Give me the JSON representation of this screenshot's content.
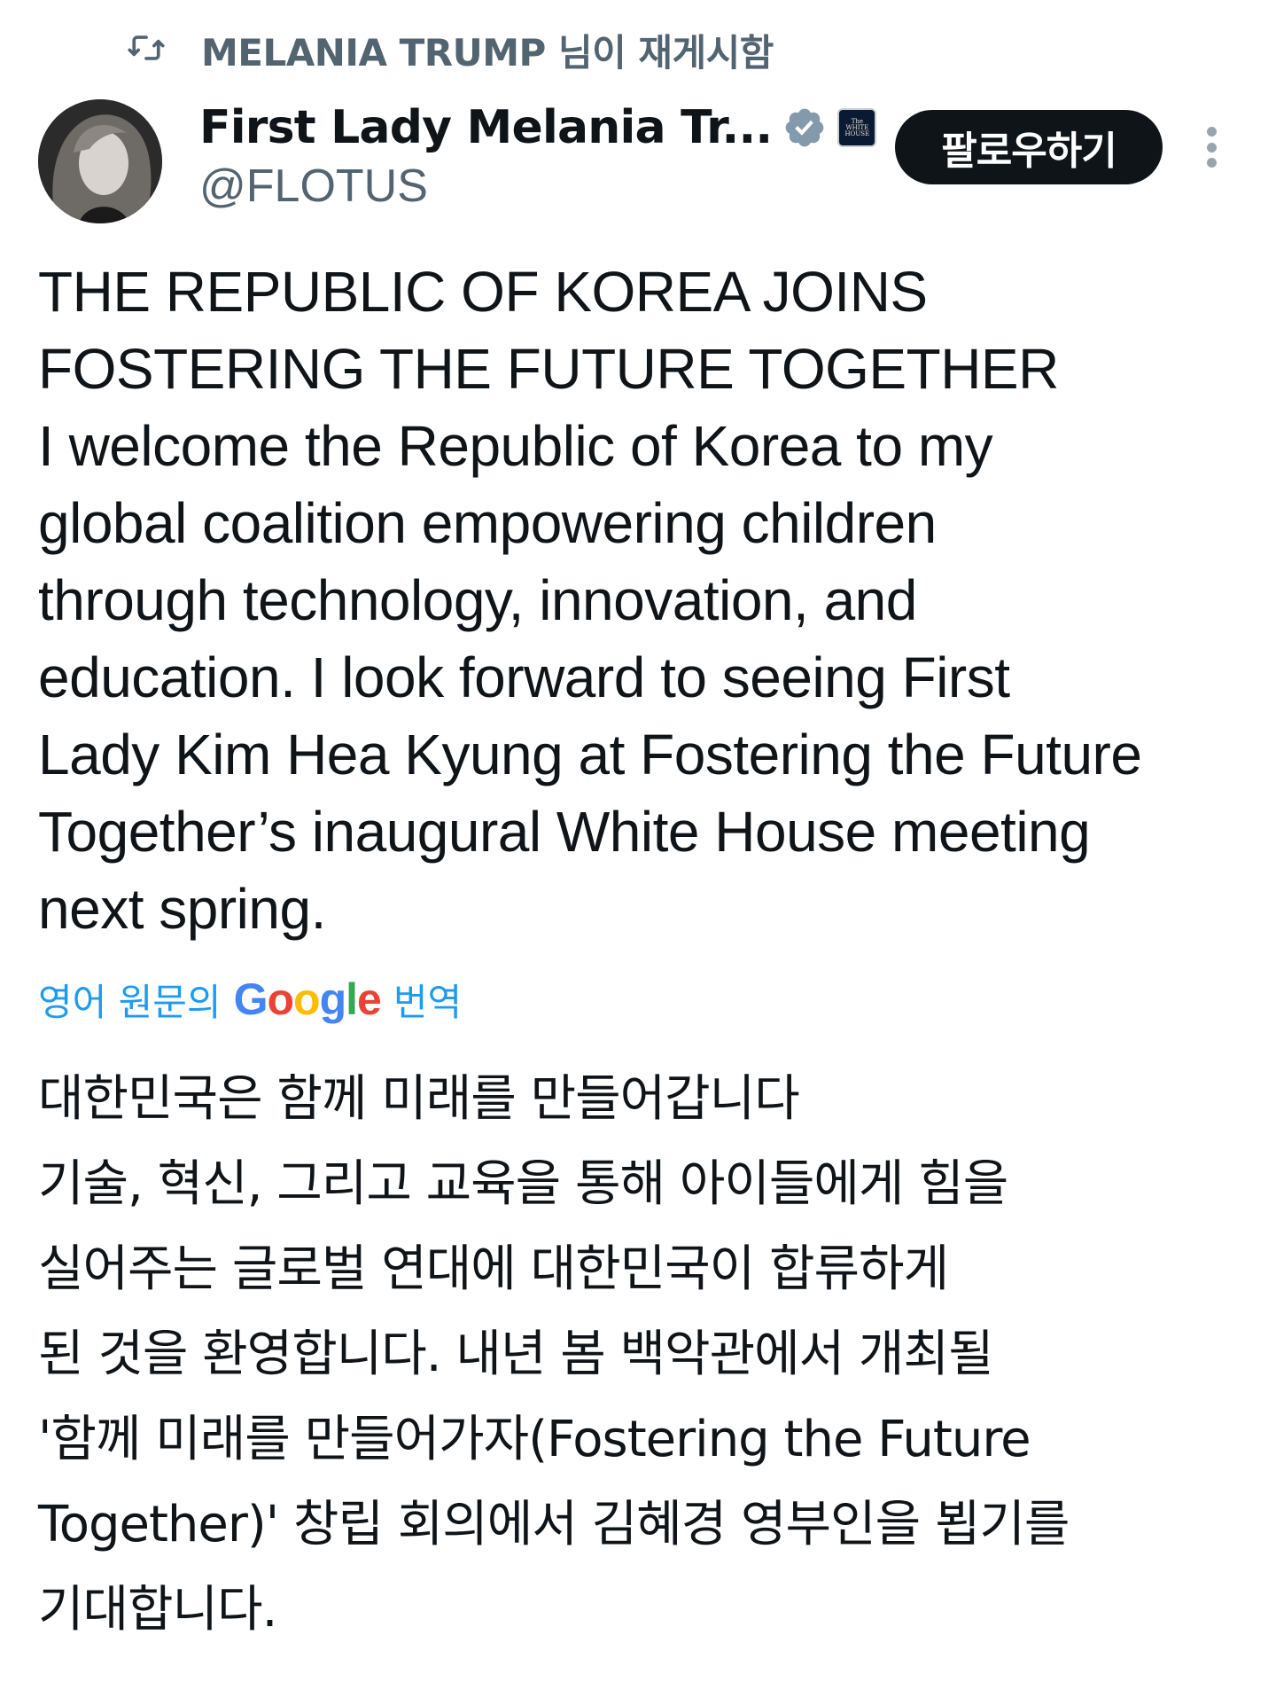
{
  "repost": {
    "icon": "repost-icon",
    "text": "MELANIA TRUMP 님이 재게시함"
  },
  "author": {
    "display_name": "First Lady Melania Tr...",
    "handle": "@FLOTUS",
    "verified_icon": "verified-badge-icon",
    "affiliation_icon": "white-house-badge-icon",
    "affiliation_text": "The WHITE HOUSE"
  },
  "follow_button": {
    "label": "팔로우하기"
  },
  "more_icon": "more-options-icon",
  "post": {
    "lines": [
      "THE REPUBLIC OF KOREA JOINS",
      "FOSTERING THE FUTURE TOGETHER",
      "I welcome the Republic of Korea to my",
      "global coalition empowering children",
      "through technology, innovation, and",
      "education. I look forward to seeing First",
      "Lady Kim Hea Kyung at Fostering the Future",
      "Together’s inaugural White House meeting",
      "next spring."
    ]
  },
  "translation": {
    "prefix": "영어 원문의",
    "google": [
      "G",
      "o",
      "o",
      "g",
      "l",
      "e"
    ],
    "suffix": "번역",
    "lines": [
      "대한민국은 함께 미래를 만들어갑니다",
      "기술, 혁신, 그리고 교육을 통해 아이들에게 힘을",
      "실어주는 글로벌 연대에 대한민국이 합류하게",
      "된 것을 환영합니다. 내년 봄 백악관에서 개최될",
      "'함께 미래를 만들어가자(Fostering the Future",
      "Together)' 창립 회의에서 김혜경 영부인을 뵙기를",
      "기대합니다."
    ]
  },
  "colors": {
    "text": "#0f1419",
    "secondary": "#536471",
    "link": "#1d9bf0",
    "verified": "#829aab",
    "button_bg": "#0f1419"
  }
}
